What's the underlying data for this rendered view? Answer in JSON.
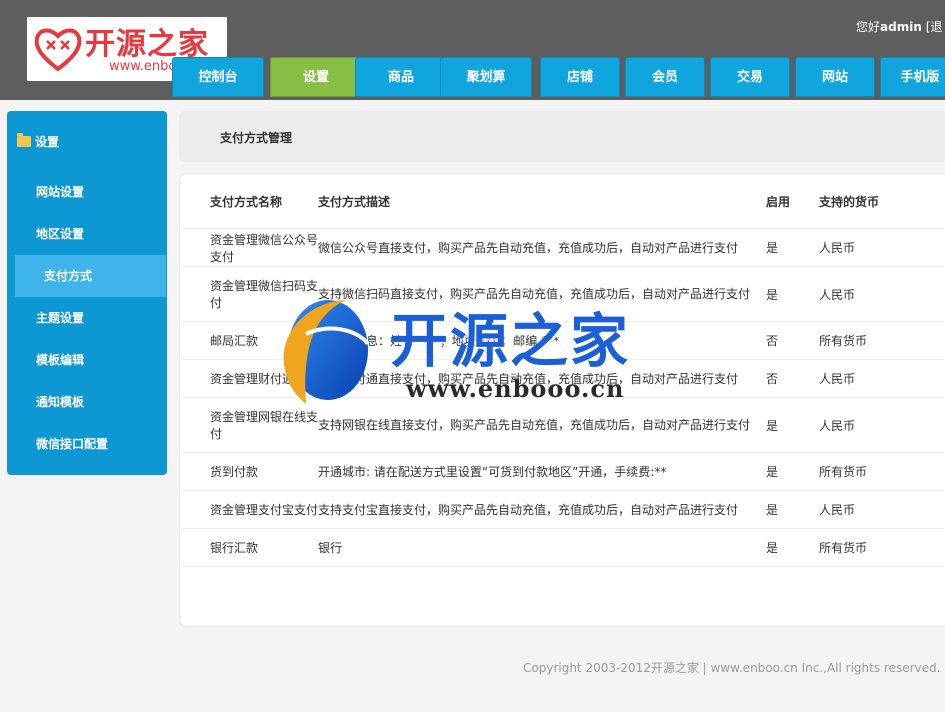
{
  "header": {
    "logo_text": "开源之家",
    "logo_url": "www.enbooo.cn",
    "greeting_prefix": "您好",
    "username": "admin",
    "logout_label": "[退"
  },
  "nav": {
    "tabs": [
      {
        "label": "控制台",
        "active": false
      },
      {
        "label": "设置",
        "active": true
      },
      {
        "label": "商品",
        "active": false
      },
      {
        "label": "聚划算",
        "active": false
      },
      {
        "label": "店铺",
        "active": false
      },
      {
        "label": "会员",
        "active": false
      },
      {
        "label": "交易",
        "active": false
      },
      {
        "label": "网站",
        "active": false
      },
      {
        "label": "手机版",
        "active": false
      }
    ]
  },
  "sidebar": {
    "title": "设置",
    "items": [
      {
        "label": "网站设置",
        "active": false
      },
      {
        "label": "地区设置",
        "active": false
      },
      {
        "label": "支付方式",
        "active": true
      },
      {
        "label": "主题设置",
        "active": false
      },
      {
        "label": "模板编辑",
        "active": false
      },
      {
        "label": "通知模板",
        "active": false
      },
      {
        "label": "微信接口配置",
        "active": false
      }
    ]
  },
  "breadcrumb": {
    "title": "支付方式管理"
  },
  "table": {
    "columns": [
      "支付方式名称",
      "支付方式描述",
      "启用",
      "支持的货币"
    ],
    "rows": [
      {
        "name": "资金管理微信公众号支付",
        "desc": "微信公众号直接支付，购买产品先自动充值，充值成功后，自动对产品进行支付",
        "enabled": "是",
        "currency": "人民币"
      },
      {
        "name": "资金管理微信扫码支付",
        "desc": "支持微信扫码直接支付，购买产品先自动充值，充值成功后，自动对产品进行支付",
        "enabled": "是",
        "currency": "人民币"
      },
      {
        "name": "邮局汇款",
        "desc": "收款人信息：姓名 *** ；地址 *** ；邮编 ***",
        "enabled": "否",
        "currency": "所有货币"
      },
      {
        "name": "资金管理财付通支付",
        "desc": "支持财付通直接支付，购买产品先自动充值，充值成功后，自动对产品进行支付",
        "enabled": "否",
        "currency": "人民币"
      },
      {
        "name": "资金管理网银在线支付",
        "desc": "支持网银在线直接支付，购买产品先自动充值，充值成功后，自动对产品进行支付",
        "enabled": "是",
        "currency": "人民币"
      },
      {
        "name": "货到付款",
        "desc": "开通城市: 请在配送方式里设置“可货到付款地区”开通，手续费:**",
        "enabled": "是",
        "currency": "所有货币"
      },
      {
        "name": "资金管理支付宝支付",
        "desc": "支持支付宝直接支付，购买产品先自动充值，充值成功后，自动对产品进行支付",
        "enabled": "是",
        "currency": "人民币"
      },
      {
        "name": "银行汇款",
        "desc": "银行",
        "enabled": "是",
        "currency": "所有货币"
      }
    ]
  },
  "footer": {
    "text": "Copyright 2003-2012开源之家 | www.enboo.cn Inc.,All rights reserved."
  },
  "watermark": {
    "text": "开源之家",
    "url": "www.enbooo.cn"
  },
  "colors": {
    "accent": "#11a5de",
    "active_tab": "#87bf44",
    "sidebar": "#0e98d3",
    "topbar": "#5e5e5e"
  }
}
